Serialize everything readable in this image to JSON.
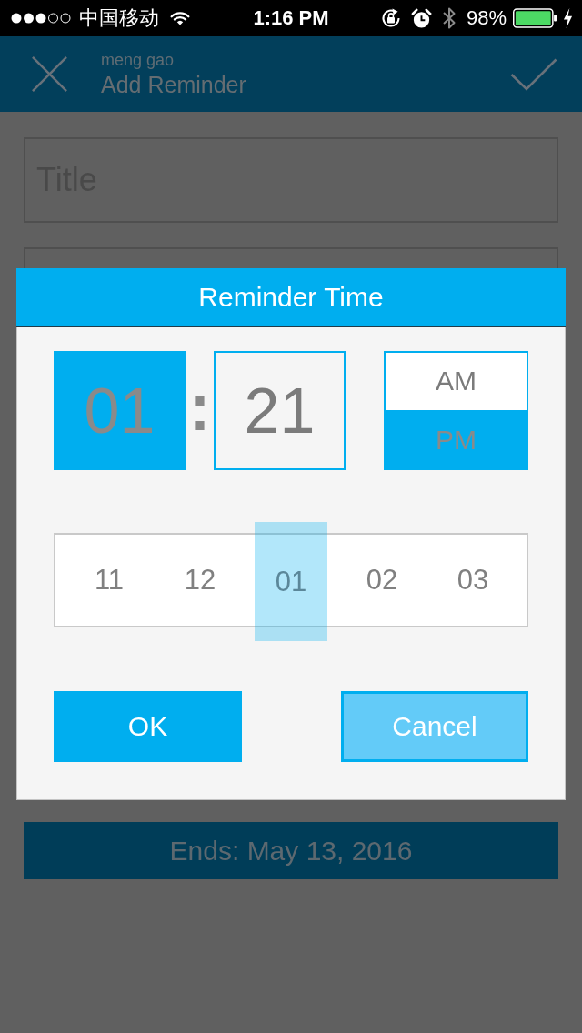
{
  "status_bar": {
    "carrier": "中国移动",
    "time": "1:16 PM",
    "battery": "98%"
  },
  "header": {
    "account": "meng gao",
    "title": "Add Reminder"
  },
  "title_field": {
    "placeholder": "Title"
  },
  "dialog": {
    "title": "Reminder Time",
    "time_segments": [
      {
        "value": "01",
        "selected": true
      },
      {
        "value": "21",
        "selected": false
      }
    ],
    "separator": ":",
    "periods": [
      {
        "label": "AM",
        "selected": false
      },
      {
        "label": "PM",
        "selected": true
      }
    ],
    "hour_options": [
      {
        "label": "11",
        "selected": false
      },
      {
        "label": "12",
        "selected": false
      },
      {
        "label": "01",
        "selected": true
      },
      {
        "label": "02",
        "selected": false
      },
      {
        "label": "03",
        "selected": false
      }
    ],
    "buttons": [
      {
        "label": "OK",
        "kind": "primary"
      },
      {
        "label": "Cancel",
        "kind": "secondary"
      }
    ]
  },
  "ends_button": {
    "label": "Ends: May 13, 2016"
  }
}
